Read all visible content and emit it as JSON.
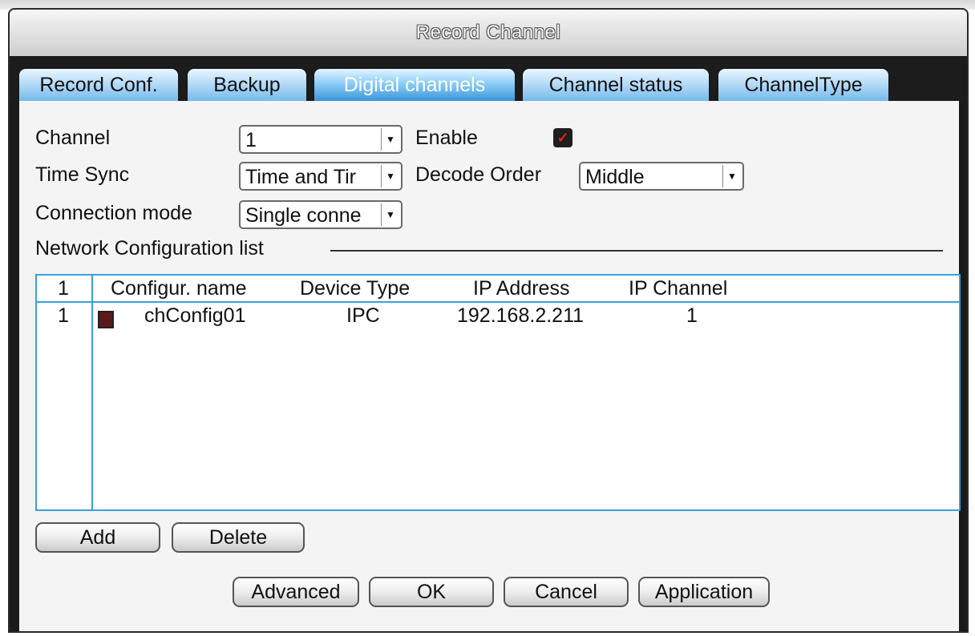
{
  "window": {
    "title": "Record Channel"
  },
  "tabs": [
    {
      "label": "Record Conf."
    },
    {
      "label": "Backup"
    },
    {
      "label": "Digital channels",
      "active": true
    },
    {
      "label": "Channel status"
    },
    {
      "label": "ChannelType"
    }
  ],
  "form": {
    "channel_label": "Channel",
    "channel_value": "1",
    "enable_label": "Enable",
    "enable_checked": true,
    "time_sync_label": "Time Sync",
    "time_sync_value": "Time and Tir",
    "decode_order_label": "Decode Order",
    "decode_order_value": "Middle",
    "connection_mode_label": "Connection mode",
    "connection_mode_value": "Single conne"
  },
  "network_list": {
    "title": "Network Configuration list",
    "header": {
      "index": "1",
      "config_name": "Configur. name",
      "device_type": "Device Type",
      "ip_address": "IP Address",
      "ip_channel": "IP Channel"
    },
    "rows": [
      {
        "index": "1",
        "checked": true,
        "config_name": "chConfig01",
        "device_type": "IPC",
        "ip_address": "192.168.2.211",
        "ip_channel": "1"
      }
    ]
  },
  "list_buttons": {
    "add": "Add",
    "delete": "Delete"
  },
  "footer_buttons": {
    "advanced": "Advanced",
    "ok": "OK",
    "cancel": "Cancel",
    "application": "Application"
  },
  "icons": {
    "dropdown": "chevron-down-icon",
    "checkbox": "checkmark-icon"
  },
  "colors": {
    "tab_active": "#3c96da",
    "tab_inactive": "#74baec",
    "list_border": "#3aa0d8",
    "checkmark": "#e02020"
  }
}
